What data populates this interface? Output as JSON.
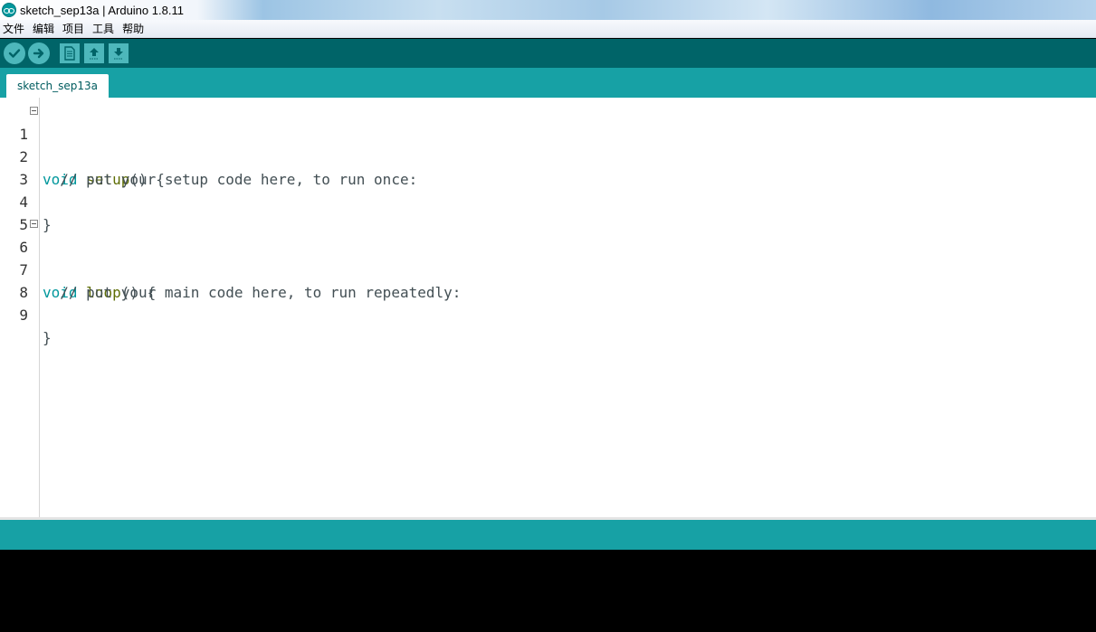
{
  "window": {
    "title": "sketch_sep13a | Arduino 1.8.11",
    "logo_icon": "arduino-logo-icon"
  },
  "menubar": {
    "items": [
      "文件",
      "编辑",
      "项目",
      "工具",
      "帮助"
    ]
  },
  "toolbar": {
    "buttons": [
      {
        "name": "verify",
        "icon": "checkmark-icon"
      },
      {
        "name": "upload",
        "icon": "arrow-right-icon"
      },
      {
        "name": "new",
        "icon": "new-file-icon"
      },
      {
        "name": "open",
        "icon": "arrow-up-icon"
      },
      {
        "name": "save",
        "icon": "arrow-down-icon"
      }
    ]
  },
  "tabs": [
    {
      "label": "sketch_sep13a",
      "active": true
    }
  ],
  "editor": {
    "lines": [
      {
        "no": "1",
        "kw": "void",
        "fn": "setup",
        "rest": "() {",
        "fold": true
      },
      {
        "no": "2",
        "text": "  // put your setup code here, to run once:"
      },
      {
        "no": "3",
        "text": ""
      },
      {
        "no": "4",
        "text": "}"
      },
      {
        "no": "5",
        "text": ""
      },
      {
        "no": "6",
        "kw": "void",
        "fn": "loop",
        "rest": "() {",
        "fold": true
      },
      {
        "no": "7",
        "text": "  // put your main code here, to run repeatedly:"
      },
      {
        "no": "8",
        "text": ""
      },
      {
        "no": "9",
        "text": "}"
      }
    ]
  },
  "colors": {
    "toolbar_bg": "#006468",
    "tabbar_bg": "#17a1a5",
    "button_bg": "#4db7bb",
    "keyword": "#00979c",
    "function": "#5e6d03",
    "console_bg": "#000000"
  }
}
